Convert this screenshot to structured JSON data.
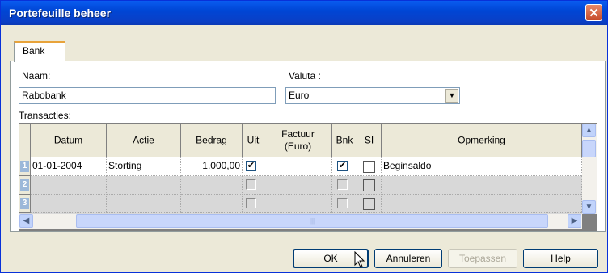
{
  "window": {
    "title": "Portefeuille beheer",
    "close_glyph": "✕"
  },
  "tabs": [
    {
      "label": "Bank"
    }
  ],
  "form": {
    "naam_label": "Naam:",
    "naam_value": "Rabobank",
    "valuta_label": "Valuta :",
    "valuta_value": "Euro",
    "transacties_label": "Transacties:"
  },
  "table": {
    "columns": [
      "Datum",
      "Actie",
      "Bedrag",
      "Uit",
      "Factuur (Euro)",
      "Bnk",
      "SI",
      "Opmerking"
    ],
    "rows": [
      {
        "num": "1",
        "datum": "01-01-2004",
        "actie": "Storting",
        "bedrag": "1.000,00",
        "uit": "✔",
        "factuur": "",
        "bnk": "✔",
        "si": "",
        "opmerking": "Beginsaldo"
      },
      {
        "num": "2",
        "datum": "",
        "actie": "",
        "bedrag": "",
        "uit": "",
        "factuur": "",
        "bnk": "",
        "si": "",
        "opmerking": ""
      },
      {
        "num": "3",
        "datum": "",
        "actie": "",
        "bedrag": "",
        "uit": "",
        "factuur": "",
        "bnk": "",
        "si": "",
        "opmerking": ""
      }
    ]
  },
  "scroll": {
    "up": "▲",
    "down": "▼",
    "left": "◀",
    "right": "▶",
    "grip": "|||",
    "dropdown": "▼"
  },
  "buttons": {
    "ok": "OK",
    "annuleren": "Annuleren",
    "toepassen": "Toepassen",
    "help": "Help"
  },
  "colors": {
    "titlebar": "#0a5cf0",
    "accent_tab": "#e8a33a",
    "row_selected": "#ffffff",
    "row_empty": "#d8d8d8"
  }
}
